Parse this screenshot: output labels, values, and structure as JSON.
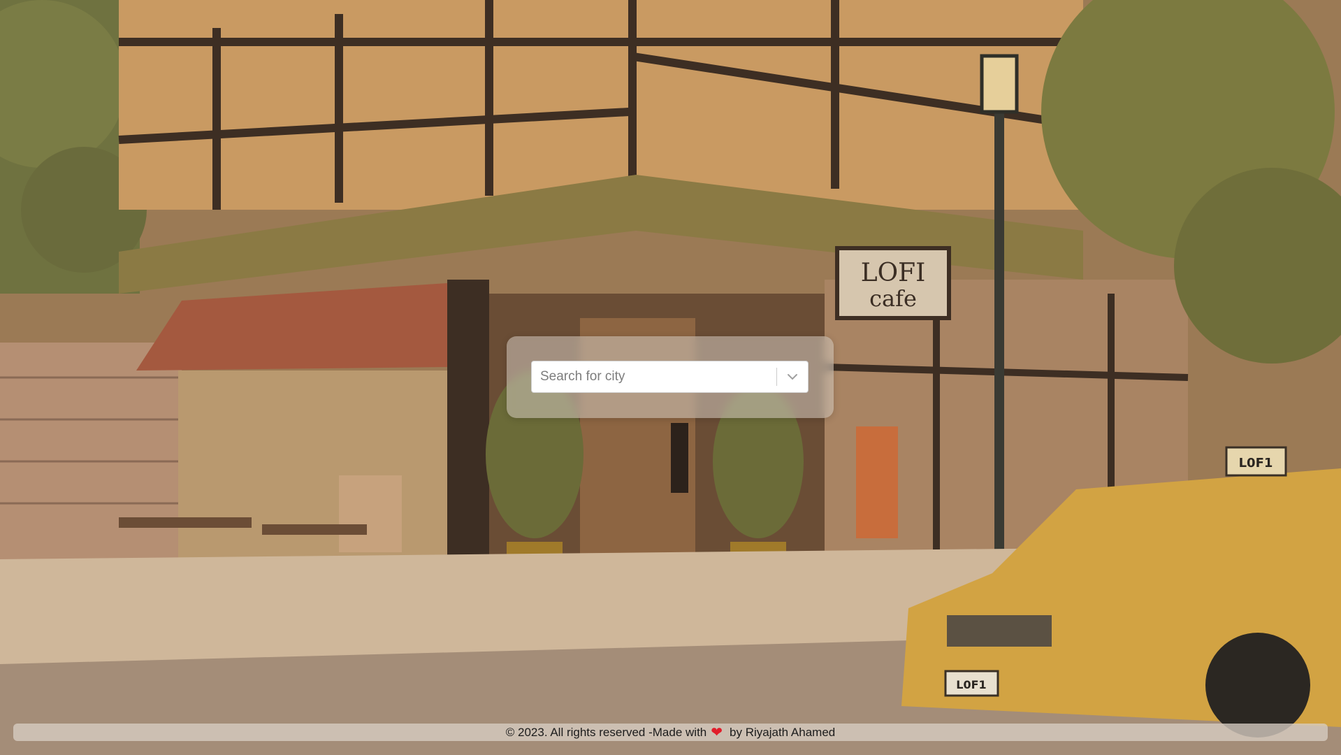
{
  "background": {
    "description_icon": "lofi-cafe-illustration",
    "sign_line1": "LOFI",
    "sign_line2": "cafe",
    "taxi_roof_sign": "L0F1",
    "taxi_plate": "L0F1"
  },
  "search": {
    "placeholder": "Search for city",
    "value": "",
    "dropdown_icon": "chevron-down-icon"
  },
  "footer": {
    "text_before": "© 2023. All rights reserved -Made with",
    "heart_icon": "heart-icon",
    "heart_glyph": "❤",
    "text_after": "by Riyajath Ahamed"
  },
  "colors": {
    "heart": "#e11d2a",
    "card_bg": "rgba(210,200,190,0.55)",
    "footer_bg": "rgba(215,205,195,0.78)"
  }
}
